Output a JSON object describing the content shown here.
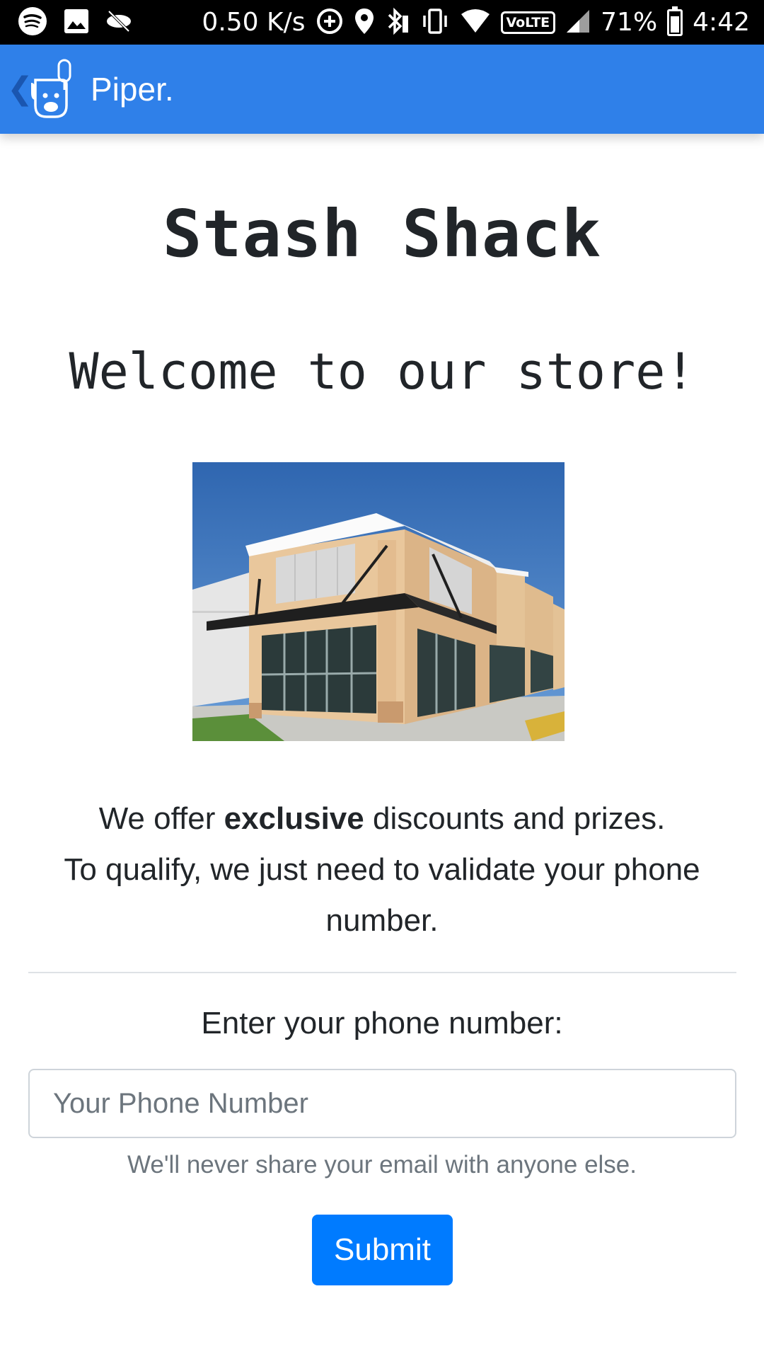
{
  "status_bar": {
    "net_speed": "0.50 K/s",
    "volte": "VoLTE",
    "battery": "71%",
    "time": "4:42",
    "icons": [
      "spotify-icon",
      "gallery-icon",
      "do-not-disturb-icon",
      "data-saver-icon",
      "location-icon",
      "bluetooth-icon",
      "vibrate-icon",
      "wifi-icon",
      "signal-icon",
      "battery-icon"
    ],
    "battery_level": 0.71
  },
  "app_bar": {
    "title": "Piper.",
    "accent": "#2f80e9"
  },
  "page": {
    "title": "Stash Shack",
    "welcome": "Welcome to our store!",
    "offer_part1": "We offer ",
    "offer_bold": "exclusive",
    "offer_part2": " discounts and prizes.",
    "offer_line2": "To qualify, we just need to validate your phone number.",
    "phone_label": "Enter your phone number:",
    "phone_placeholder": "Your Phone Number",
    "phone_value": "",
    "help_text": "We'll never share your email with anyone else.",
    "submit_label": "Submit",
    "button_color": "#007bff"
  }
}
